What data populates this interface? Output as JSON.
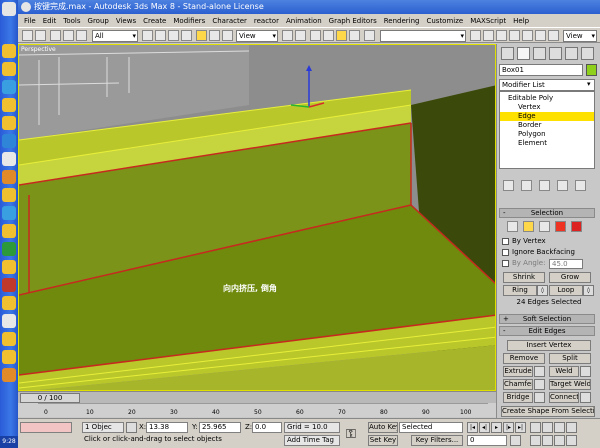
{
  "window": {
    "title": "按键完成.max - Autodesk 3ds Max 8 - Stand-alone License"
  },
  "menu": [
    "File",
    "Edit",
    "Tools",
    "Group",
    "Views",
    "Create",
    "Modifiers",
    "Character",
    "reactor",
    "Animation",
    "Graph Editors",
    "Rendering",
    "Customize",
    "MAXScript",
    "Help"
  ],
  "toolbar": {
    "selection_filter": "All",
    "ref_coord": "View",
    "named_selection": "",
    "ref_coord_right": "View"
  },
  "viewport": {
    "label": "Perspective",
    "annotation": "向内挤压, 倒角",
    "colors": {
      "floor": "#6e8a0c",
      "wall": "#a7b52a",
      "edge_red": "#c62a1e",
      "edge_yellow": "#e8ef3a"
    }
  },
  "command_panel": {
    "object_name": "Box01",
    "object_color": "#8fd01c",
    "modifier_list": "Modifier List",
    "stack": [
      "Editable Poly",
      "Vertex",
      "Edge",
      "Border",
      "Polygon",
      "Element"
    ],
    "selected_stack_item": "Edge",
    "selection_rollout": {
      "title": "Selection",
      "by_vertex": "By Vertex",
      "ignore_backfacing": "Ignore Backfacing",
      "by_angle": "By Angle:",
      "by_angle_value": "45.0",
      "shrink": "Shrink",
      "grow": "Grow",
      "ring": "Ring",
      "loop": "Loop",
      "status": "24 Edges Selected"
    },
    "soft_selection": "Soft Selection",
    "edit_edges": {
      "title": "Edit Edges",
      "insert_vertex": "Insert Vertex",
      "remove": "Remove",
      "split": "Split",
      "extrude": "Extrude",
      "weld": "Weld",
      "chamfer": "Chamfer",
      "target_weld": "Target Weld",
      "bridge": "Bridge",
      "connect": "Connect",
      "create_shape": "Create Shape From Selection"
    }
  },
  "timeline": {
    "slider": "0 / 100",
    "ticks": [
      "0",
      "10",
      "20",
      "30",
      "40",
      "50",
      "60",
      "70",
      "80",
      "90",
      "100"
    ]
  },
  "status": {
    "objects": "1 Objec",
    "x_label": "X:",
    "x_value": "13.38",
    "y_label": "Y:",
    "y_value": "25.965",
    "z_label": "Z:",
    "z_value": "0.0",
    "grid": "Grid = 10.0",
    "auto_key": "Auto Key",
    "auto_key_mode": "Selected",
    "set_key": "Set Key",
    "key_filters": "Key Filters...",
    "prompt": "Click or click-and-drag to select objects",
    "time_tag": "Add Time Tag",
    "frame": "0",
    "clock": "9:28"
  }
}
